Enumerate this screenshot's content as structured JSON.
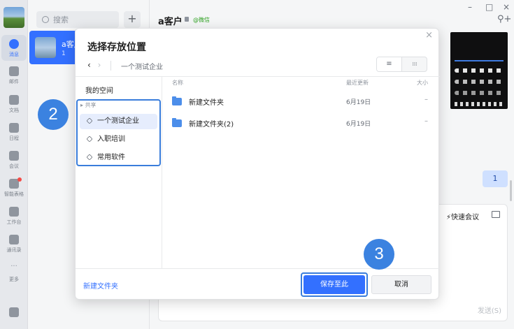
{
  "sidebar": {
    "items": [
      {
        "label": "消息",
        "icon": "chat-bubble-icon"
      },
      {
        "label": "邮件",
        "icon": "mail-icon"
      },
      {
        "label": "文档",
        "icon": "document-icon"
      },
      {
        "label": "日程",
        "icon": "calendar-icon"
      },
      {
        "label": "会议",
        "icon": "meeting-icon"
      },
      {
        "label": "智能表格",
        "icon": "smart-sheet-icon"
      },
      {
        "label": "工作台",
        "icon": "workbench-icon"
      },
      {
        "label": "通讯录",
        "icon": "contacts-icon"
      },
      {
        "label": "更多",
        "icon": "more-icon"
      }
    ]
  },
  "conversations": {
    "search_placeholder": "搜索",
    "add_label": "+",
    "active": {
      "name": "a客户",
      "preview": "1"
    }
  },
  "chat": {
    "title": "a客户",
    "channel_tag": "@微信",
    "bubble_text": "1",
    "quick_meeting": "快速会议",
    "send_label": "发送(S)",
    "window_minimize": "–",
    "window_maximize": "□",
    "window_close": "×"
  },
  "dialog": {
    "title": "选择存放位置",
    "close_label": "×",
    "back_label": "‹",
    "forward_label": "›",
    "breadcrumb": "一个测试企业",
    "view_list_icon": "≡",
    "view_grid_icon": "⁞⁞⁞",
    "tree": {
      "my_space": "我的空间",
      "shared_header": "共享",
      "shared_items": [
        "一个测试企业",
        "入职培训",
        "常用软件"
      ]
    },
    "columns": {
      "name": "名称",
      "updated": "最近更新",
      "size": "大小"
    },
    "files": [
      {
        "name": "新建文件夹",
        "updated": "6月19日",
        "size": "–"
      },
      {
        "name": "新建文件夹(2)",
        "updated": "6月19日",
        "size": "–"
      }
    ],
    "new_folder_label": "新建文件夹",
    "save_label": "保存至此",
    "cancel_label": "取消"
  },
  "annotations": {
    "step_2": "2",
    "step_3": "3"
  },
  "colors": {
    "accent": "#3370ff",
    "annotation": "#3b82e0"
  }
}
